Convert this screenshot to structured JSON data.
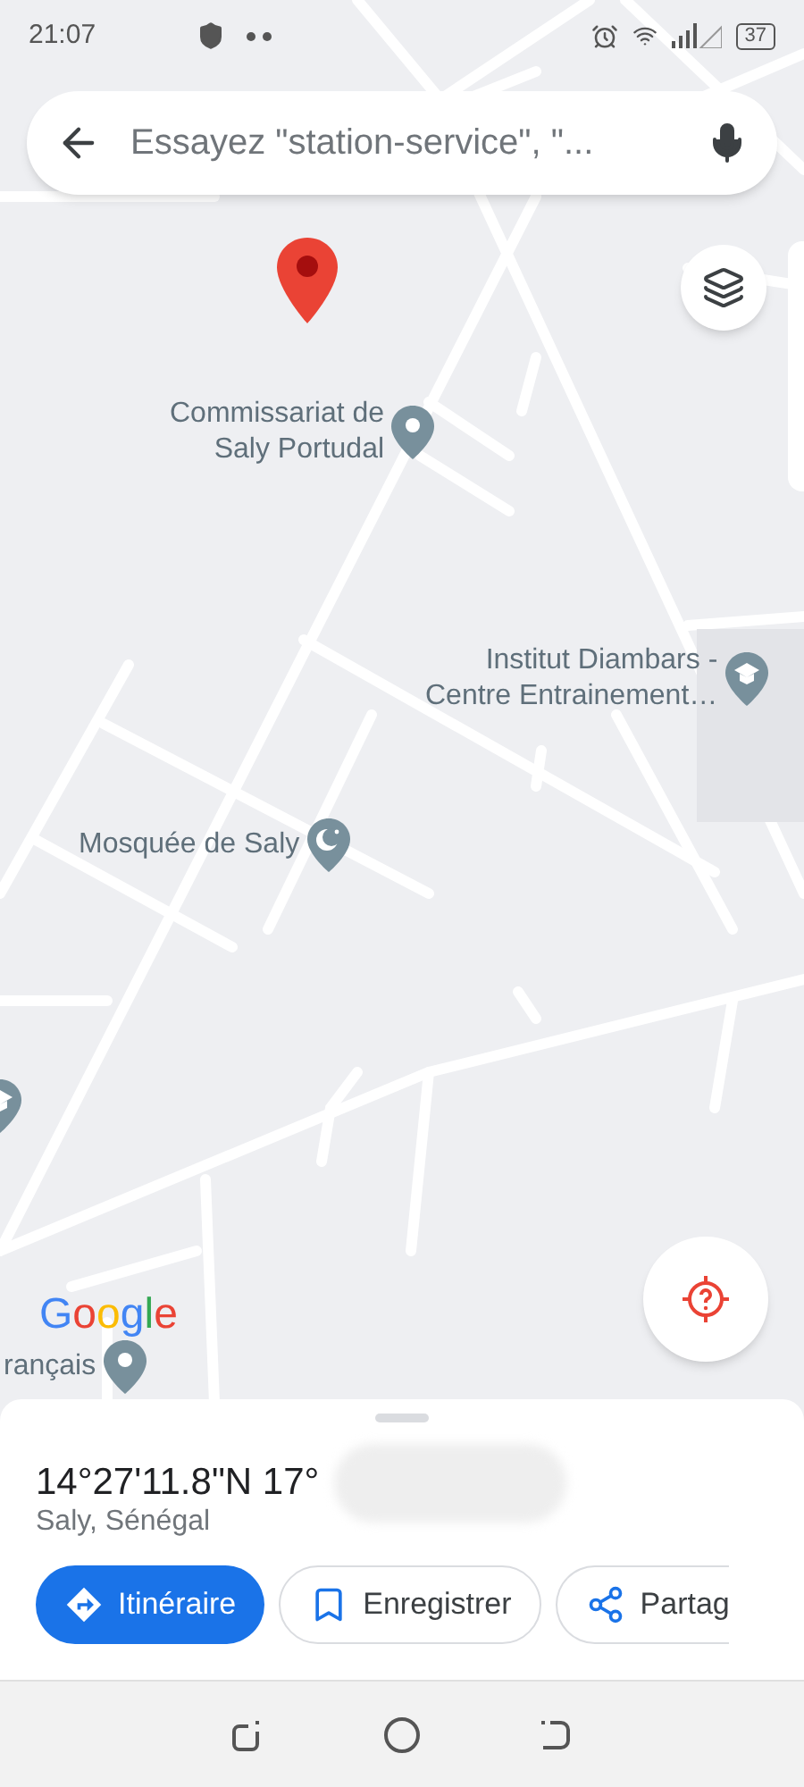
{
  "status_bar": {
    "time": "21:07",
    "battery": "37"
  },
  "search": {
    "placeholder": "Essayez \"station-service\", \"..."
  },
  "map": {
    "labels": [
      {
        "text": "Commissariat de\nSaly Portudal",
        "kind": "pin"
      },
      {
        "text": "Institut Diambars -\nCentre Entrainement…",
        "kind": "school"
      },
      {
        "text": "Mosquée de Saly",
        "kind": "mosque"
      },
      {
        "text": "rançais",
        "kind": "pin"
      }
    ],
    "logo": "Google"
  },
  "place": {
    "coordinates": "14°27'11.8\"N 17°",
    "locality": "Saly, Sénégal"
  },
  "actions": [
    {
      "label": "Itinéraire",
      "kind": "primary"
    },
    {
      "label": "Enregistrer",
      "kind": "save"
    },
    {
      "label": "Partag",
      "kind": "share"
    }
  ]
}
